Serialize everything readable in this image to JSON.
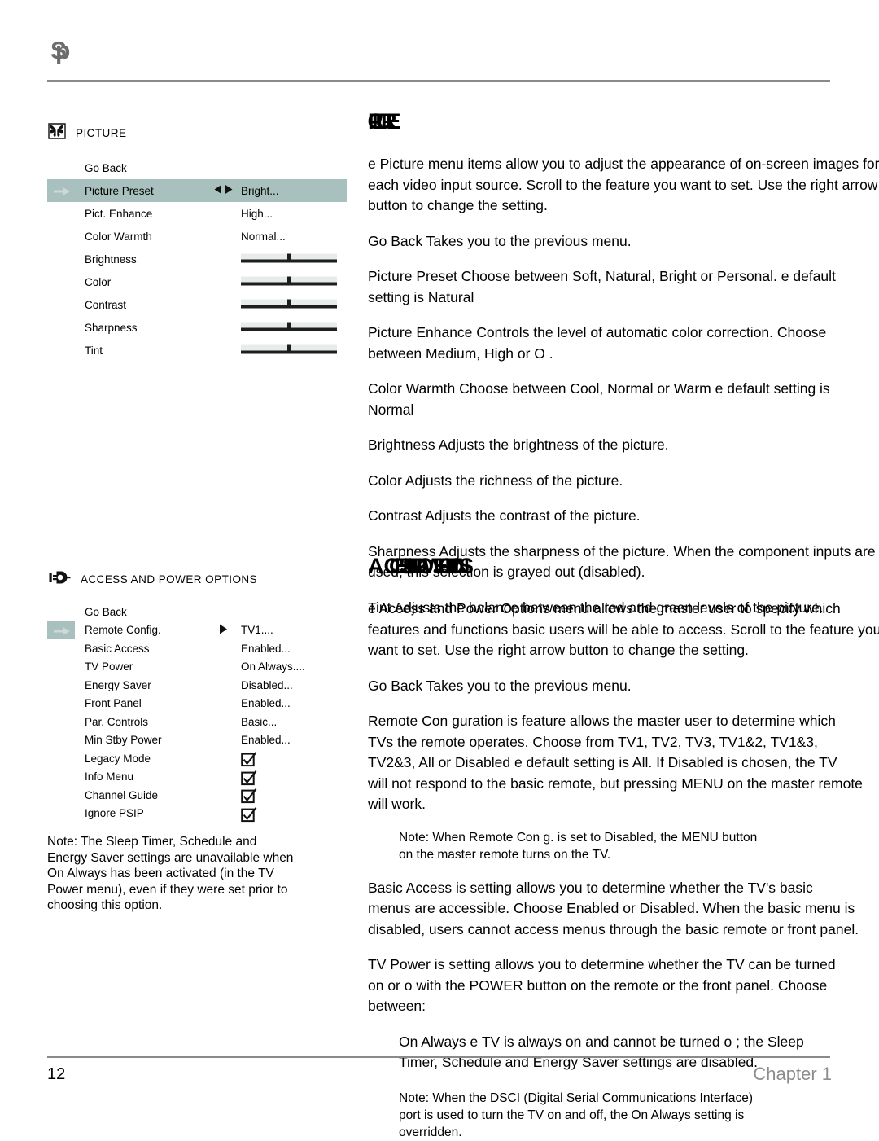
{
  "document": {
    "header_glyph": "Sp",
    "page_number": "12",
    "chapter_label": "Chapter 1"
  },
  "picture_menu": {
    "icon": "butterfly-picture-icon",
    "title": "PICTURE",
    "highlight_color": "#a9c1be",
    "rows": [
      {
        "label": "Go Back",
        "value": "",
        "widget": "none",
        "selected": false,
        "arrows": "none"
      },
      {
        "label": "Picture Preset",
        "value": "Bright...",
        "widget": "none",
        "selected": true,
        "arrows": "left-right"
      },
      {
        "label": "Pict. Enhance",
        "value": "High...",
        "widget": "none",
        "selected": false,
        "arrows": "none"
      },
      {
        "label": "Color Warmth",
        "value": "Normal...",
        "widget": "none",
        "selected": false,
        "arrows": "none"
      },
      {
        "label": "Brightness",
        "value": "",
        "widget": "slider",
        "selected": false,
        "arrows": "none"
      },
      {
        "label": "Color",
        "value": "",
        "widget": "slider",
        "selected": false,
        "arrows": "none"
      },
      {
        "label": "Contrast",
        "value": "",
        "widget": "slider",
        "selected": false,
        "arrows": "none"
      },
      {
        "label": "Sharpness",
        "value": "",
        "widget": "slider",
        "selected": false,
        "arrows": "none"
      },
      {
        "label": "Tint",
        "value": "",
        "widget": "slider",
        "selected": false,
        "arrows": "none"
      }
    ]
  },
  "access_menu": {
    "icon": "power-plug-icon",
    "title": "ACCESS AND POWER OPTIONS",
    "highlight_color": "#a9c1be",
    "rows": [
      {
        "label": "Go Back",
        "value": "",
        "widget": "none",
        "selected": false,
        "arrows": "none"
      },
      {
        "label": "Remote Config.",
        "value": "TV1....",
        "widget": "none",
        "selected": true,
        "arrows": "right"
      },
      {
        "label": "Basic Access",
        "value": "Enabled...",
        "widget": "none",
        "selected": false,
        "arrows": "none"
      },
      {
        "label": "TV Power",
        "value": "On Always....",
        "widget": "none",
        "selected": false,
        "arrows": "none"
      },
      {
        "label": "Energy Saver",
        "value": "Disabled...",
        "widget": "none",
        "selected": false,
        "arrows": "none"
      },
      {
        "label": "Front Panel",
        "value": "Enabled...",
        "widget": "none",
        "selected": false,
        "arrows": "none"
      },
      {
        "label": "Par. Controls",
        "value": "Basic...",
        "widget": "none",
        "selected": false,
        "arrows": "none"
      },
      {
        "label": "Min Stby Power",
        "value": "Enabled...",
        "widget": "none",
        "selected": false,
        "arrows": "none"
      },
      {
        "label": "Legacy Mode",
        "value": "",
        "widget": "checkbox",
        "selected": false,
        "arrows": "none"
      },
      {
        "label": "Info Menu",
        "value": "",
        "widget": "checkbox",
        "selected": false,
        "arrows": "none"
      },
      {
        "label": "Channel Guide",
        "value": "",
        "widget": "checkbox",
        "selected": false,
        "arrows": "none"
      },
      {
        "label": "Ignore PSIP",
        "value": "",
        "widget": "checkbox",
        "selected": false,
        "arrows": "none"
      }
    ]
  },
  "left_note": {
    "lines": [
      "Note:  The Sleep Timer, Schedule and",
      "Energy Saver settings are unavailable when",
      "On Always has been activated (in the TV",
      "Power menu), even if they were set prior to",
      "choosing this option."
    ]
  },
  "picture_section": {
    "heading_first": "",
    "heading_squeezed": "PICTURE",
    "intro": [
      " e   Picture menu items allow you to adjust the appearance of on-screen images for",
      "each video input source. Scroll to the feature you want to set. Use the right arrow",
      "button to change the setting."
    ],
    "items": [
      {
        "lines": [
          "Go Back  Takes you to the previous menu."
        ]
      },
      {
        "lines": [
          "Picture Preset  Choose between Soft, Natural, Bright or Personal. e default",
          "setting is Natural"
        ]
      },
      {
        "lines": [
          "Picture Enhance  Controls the level of automatic color correction. Choose",
          "between Medium, High or O ."
        ]
      },
      {
        "lines": [
          "Color Warmth   Choose between Cool, Normal or Warm  e default setting is",
          "Normal"
        ]
      },
      {
        "lines": [
          "Brightness  Adjusts the brightness of the picture."
        ]
      },
      {
        "lines": [
          "Color   Adjusts the richness of the picture."
        ]
      },
      {
        "lines": [
          "Contrast   Adjusts the contrast of the picture."
        ]
      },
      {
        "lines": [
          "Sharpness Adjusts the sharpness of the picture. When the component inputs are",
          "used, this selection is grayed out (disabled)."
        ]
      },
      {
        "lines": [
          "Tint    Adjusts the balance between the red and green levels of the picture."
        ]
      }
    ]
  },
  "access_section": {
    "heading_first": "A",
    "heading_squeezed": "CCESS AND POWER OPTIONS",
    "intro": [
      " e   Access and Power Options menu allows the master user to specify which",
      "features and functions basic users will be able to access. Scroll to the feature you",
      "want to set. Use the right arrow button to change the setting."
    ],
    "items": [
      {
        "lines": [
          "Go Back  Takes you to the previous menu."
        ]
      },
      {
        "lines": [
          "Remote Con guration    is feature allows the master user to determine which",
          "TVs the remote operates. Choose from TV1, TV2, TV3, TV1&2, TV1&3,",
          "TV2&3, All or Disabled  e default setting is All. If Disabled is chosen, the TV",
          "will not respond to the basic remote, but pressing MENU on the master remote",
          "will work."
        ]
      },
      {
        "note": true,
        "lines": [
          "Note:  When Remote Con g. is set to Disabled, the MENU button",
          "on the master remote turns on the TV."
        ]
      },
      {
        "lines": [
          "Basic Access  is setting allows you to determine whether the TV's basic",
          "menus are accessible. Choose Enabled or Disabled. When the basic menu is",
          "disabled, users cannot access menus through the basic remote or front panel."
        ]
      },
      {
        "lines": [
          "TV Power   is setting allows you to determine whether the TV can be turned",
          "on or o  with the POWER button on the remote or the front panel. Choose",
          "between:"
        ]
      },
      {
        "indent": true,
        "lines": [
          "On Always   e TV is always on and cannot be turned o ; the Sleep",
          "Timer, Schedule and Energy Saver settings are disabled."
        ]
      },
      {
        "note": true,
        "indent": true,
        "lines": [
          "Note:  When the DSCI (Digital Serial Communications Interface)",
          "port is used to turn the TV on and off, the On Always setting is",
          "overridden."
        ]
      }
    ]
  }
}
